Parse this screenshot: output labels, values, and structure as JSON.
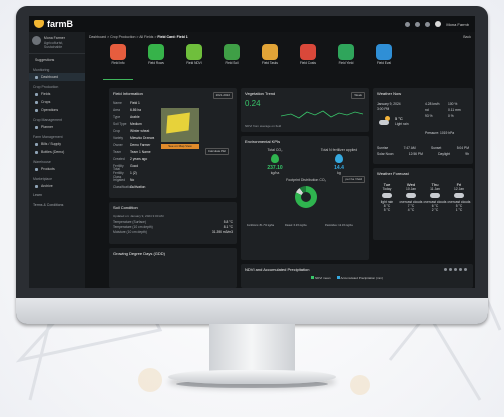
{
  "app": {
    "name": "farmB"
  },
  "topbar": {
    "user_label": "Mona Farmb"
  },
  "sidebar": {
    "user_name": "Mona Farmer",
    "user_org": "Agriculturist, Sustainable",
    "suggestions_label": "Suggestions",
    "sections": [
      {
        "title": "Monitoring",
        "items": [
          "Dashboard"
        ]
      },
      {
        "title": "Crop Production",
        "items": [
          "Fields",
          "Crops",
          "Operations"
        ]
      },
      {
        "title": "Crop Management",
        "items": [
          "Planner"
        ]
      },
      {
        "title": "Farm Management",
        "items": [
          "Bills / Supply",
          "Bottles (Demo)"
        ]
      },
      {
        "title": "Warehouse",
        "items": [
          "Products"
        ]
      },
      {
        "title": "Marketplace",
        "items": [
          "Archive"
        ]
      }
    ],
    "language": "Learn",
    "terms": "Terms & Conditions"
  },
  "breadcrumb": {
    "prefix": "Dashboard  >  Crop Production  >  All Fields  >",
    "current": "Field Card: Field 1",
    "back": "Back"
  },
  "tabs": [
    {
      "label": "Field Info",
      "color": "#e65d3e"
    },
    {
      "label": "Field Rows",
      "color": "#36b34a"
    },
    {
      "label": "Field NDVI",
      "color": "#6fbf3c"
    },
    {
      "label": "Field Soil",
      "color": "#3f9f46"
    },
    {
      "label": "Field Tasks",
      "color": "#e2a437"
    },
    {
      "label": "Field Costs",
      "color": "#d9483a"
    },
    {
      "label": "Field Yield",
      "color": "#2fa55b"
    },
    {
      "label": "Field Eval",
      "color": "#2f8fd6"
    }
  ],
  "field_info": {
    "title": "Field Information",
    "season": "2021-2022",
    "rows": [
      {
        "k": "Name",
        "v": "Field 1"
      },
      {
        "k": "Area",
        "v": "6.86 ha"
      },
      {
        "k": "Type",
        "v": "Arable"
      },
      {
        "k": "Soil Type",
        "v": "Medium"
      },
      {
        "k": "Crop",
        "v": "Winter wheat"
      },
      {
        "k": "Variety",
        "v": "Mieszko Drzewa"
      },
      {
        "k": "Owner",
        "v": "Demo Farmer"
      },
      {
        "k": "Team",
        "v": "Team 1 Name"
      },
      {
        "k": "Created",
        "v": "2 years ago"
      },
      {
        "k": "Fertility",
        "v": "Good"
      },
      {
        "k": "Total Fertility Class",
        "v": "1 (2)"
      },
      {
        "k": "Irrigated",
        "v": "No"
      },
      {
        "k": "Classification",
        "v": "Cultivation"
      }
    ],
    "map_button": "See on Map View",
    "edit_button": "Calculate PEI"
  },
  "soil": {
    "title": "Soil Condition",
    "updated": "Updated on: January 9, 2024 3:00 AM",
    "rows": [
      {
        "k": "Temperature (Surface)",
        "v": "5.8 °C"
      },
      {
        "k": "Temperature (10 cm depth)",
        "v": "8.1 °C"
      },
      {
        "k": "Moisture (10 cm depth)",
        "v": "31.390 m3/m3"
      }
    ]
  },
  "gdd": {
    "title": "Growing Degree Days (GDD)"
  },
  "veg": {
    "title": "Vegetation Trend",
    "value": "0.24",
    "sub": "NDVI from average on field",
    "period": "Week",
    "color": "#39c56a"
  },
  "env": {
    "title": "Environmental KPIs",
    "kpi1_label": "Total CO₂",
    "kpi1_value": "237.10",
    "kpi1_unit": "kg/ha",
    "kpi2_label": "Total N fertilizer applied",
    "kpi2_value": "14.4",
    "kpi2_unit": "kg",
    "distribution_title": "Footprint Distribution CO₂",
    "per_ha": "per ha / field",
    "legend": [
      "Fertilizers: 81.7% kg/ha",
      "Diesel: 6.2% kg/ha",
      "Pesticides: 12.1% kg/ha"
    ]
  },
  "weather_now": {
    "title": "Weather Now",
    "date": "January 9, 2024",
    "time": "3:00 PM",
    "temp": "5 °C",
    "condition": "Light rain",
    "stats": [
      {
        "k": "wind",
        "v": "4.28 km/h"
      },
      {
        "k": "humidity",
        "v": "100 %"
      },
      {
        "k": "uv",
        "v": "nd"
      },
      {
        "k": "rain",
        "v": "0.11 mm"
      },
      {
        "k": "feels",
        "v": "93 %"
      },
      {
        "k": "clouds",
        "v": "0 %"
      }
    ],
    "pressure": "Pressure: 1019 hPa",
    "sunrise_label": "Sunrise",
    "sunrise": "7:47 AM",
    "sunset_label": "Sunset",
    "sunset": "5:04 PM",
    "solar_label": "Solar Noon",
    "solar": "12:56 PM",
    "daylight_label": "Daylight",
    "daylight": "9h"
  },
  "forecast": {
    "title": "Weather Forecast",
    "days": [
      {
        "day": "Tue",
        "date": "Today",
        "cond": "light rain",
        "hi": "8 °C",
        "lo": "5 °C"
      },
      {
        "day": "Wed",
        "date": "10 Jan",
        "cond": "overcast clouds",
        "hi": "7 °C",
        "lo": "4 °C"
      },
      {
        "day": "Thu",
        "date": "11 Jan",
        "cond": "overcast clouds",
        "hi": "6 °C",
        "lo": "2 °C"
      },
      {
        "day": "Fri",
        "date": "12 Jan",
        "cond": "overcast clouds",
        "hi": "5 °C",
        "lo": "1 °C"
      }
    ]
  },
  "ndvi_chart": {
    "title": "NDVI and Accumulated Precipitation",
    "legend": [
      "NDVI mean",
      "Accumulated Precipitation (mm)"
    ]
  }
}
